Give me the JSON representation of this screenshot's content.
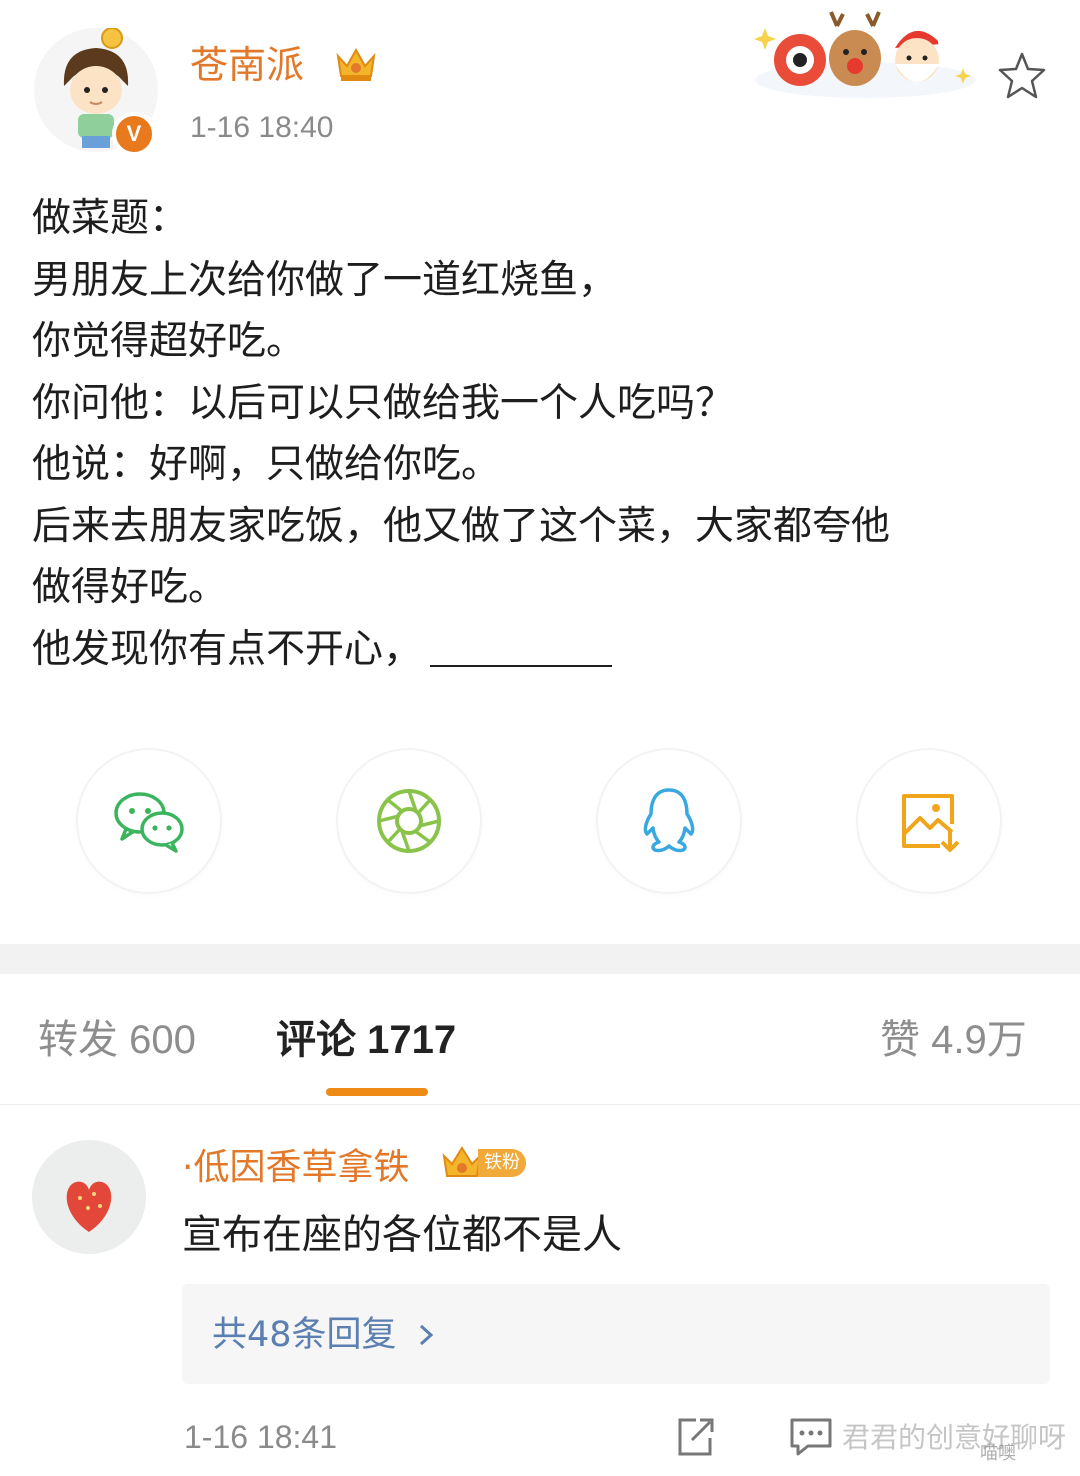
{
  "post": {
    "username": "苍南派",
    "time": "1-16 18:40",
    "verified_mark": "V",
    "icons": [
      "avatar",
      "verified-icon",
      "crown-icon",
      "holiday-mascots",
      "star-icon"
    ],
    "lines": [
      "做菜题：",
      "男朋友上次给你做了一道红烧鱼，",
      "你觉得超好吃。",
      "你问他：以后可以只做给我一个人吃吗？",
      "他说：好啊，只做给你吃。",
      "后来去朋友家吃饭，他又做了这个菜，大家都夸他",
      "做得好吃。",
      "他发现你有点不开心，"
    ]
  },
  "share": {
    "buttons": [
      "wechat-icon",
      "moments-icon",
      "qq-icon",
      "save-image-icon"
    ],
    "colors": {
      "wechat": "#3bb55d",
      "moments": "#8ac34a",
      "qq": "#3aa8e0",
      "save": "#f0a51a"
    }
  },
  "tabs": {
    "repost": "转发 600",
    "comments": "评论 1717",
    "likes": "赞 4.9万"
  },
  "comment": {
    "username": "·低因香草拿铁",
    "fan_badge": "铁粉",
    "text": "宣布在座的各位都不是人",
    "replies_link": "共48条回复",
    "time": "1-16 18:41"
  },
  "watermark": {
    "text": "君君的创意好聊呀",
    "site": "喵噢"
  },
  "colors": {
    "accent": "#e2782a",
    "tab_underline": "#f08a16",
    "link": "#5a7fb0"
  }
}
